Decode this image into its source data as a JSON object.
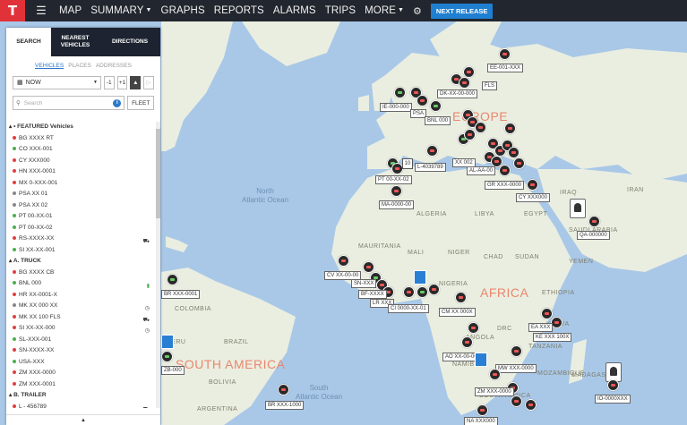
{
  "nav": {
    "logo": "T",
    "items": [
      "MAP",
      "SUMMARY",
      "GRAPHS",
      "REPORTS",
      "ALARMS",
      "TRIPS",
      "MORE"
    ],
    "dropdown_items": [
      "SUMMARY",
      "MORE"
    ],
    "next_release": "NEXT RELEASE",
    "icons": {
      "menu": "hamburger-icon",
      "settings": "gear-icon"
    }
  },
  "panel": {
    "tabs": [
      "SEARCH",
      "NEAREST VEHICLES",
      "DIRECTIONS"
    ],
    "active_tab": "SEARCH",
    "subtabs": [
      "VEHICLES",
      "PLACES",
      "ADDRESSES"
    ],
    "active_subtab": "VEHICLES",
    "time_select": "NOW",
    "step_back": "-1",
    "step_fwd": "+1",
    "search_placeholder": "Search",
    "fleet_button": "FLEET",
    "groups": [
      {
        "title": "• FEATURED Vehicles",
        "rows": [
          {
            "label": "BG XXXX RT",
            "dot": "#e04040"
          },
          {
            "label": "CO XXX-001",
            "dot": "#4caf50"
          },
          {
            "label": "CY XXX000",
            "dot": "#e04040"
          },
          {
            "label": "HN XXX-0001",
            "dot": "#e04040"
          },
          {
            "label": "MX 0-XXX-001",
            "dot": "#e04040"
          },
          {
            "label": "PSA XX 01",
            "dot": "#888888"
          },
          {
            "label": "PSA XX 02",
            "dot": "#888888"
          },
          {
            "label": "PT 00-XX-01",
            "dot": "#4caf50"
          },
          {
            "label": "PT 00-XX-02",
            "dot": "#4caf50"
          },
          {
            "label": "RS-XXXX-XX",
            "dot": "#e04040",
            "icon": "truck-icon"
          },
          {
            "label": "SI XX-XX-001",
            "dot": "#4caf50"
          }
        ]
      },
      {
        "title": "A. TRUCK",
        "rows": [
          {
            "label": "BG XXXX CB",
            "dot": "#e04040"
          },
          {
            "label": "BNL 000",
            "dot": "#4caf50",
            "icon": "battery-icon"
          },
          {
            "label": "HR XX-0001-X",
            "dot": "#e04040"
          },
          {
            "label": "MK XX 000 XX",
            "dot": "#888888",
            "icon": "clock-icon"
          },
          {
            "label": "MK XX 100 FLS",
            "dot": "#e04040",
            "icon": "truck-icon"
          },
          {
            "label": "SI XX-XX-000",
            "dot": "#e04040",
            "icon": "clock-icon"
          },
          {
            "label": "SL-XXX-001",
            "dot": "#4caf50"
          },
          {
            "label": "SN-XXXX-XX",
            "dot": "#e04040"
          },
          {
            "label": "USA-XXX",
            "dot": "#4caf50"
          },
          {
            "label": "ZM XXX-0000",
            "dot": "#e04040"
          },
          {
            "label": "ZM XXX-0001",
            "dot": "#e04040"
          }
        ]
      },
      {
        "title": "B. TRAILER",
        "rows": [
          {
            "label": "L - 456789",
            "dot": "#e04040",
            "icon": "truck-icon"
          }
        ]
      }
    ]
  },
  "map": {
    "regions": [
      "EUROPE",
      "AFRICA",
      "SOUTH AMERICA"
    ],
    "oceans": [
      "North\nAtlantic Ocean",
      "South\nAtlantic Ocean"
    ],
    "countries": [
      "ALGERIA",
      "LIBYA",
      "EGYPT",
      "MALI",
      "NIGER",
      "CHAD",
      "SUDAN",
      "ETHIOPIA",
      "BRAZIL",
      "COLOMBIA",
      "PERU",
      "BOLIVIA",
      "ARGENTINA",
      "SAUDI ARABIA",
      "YEMEN",
      "IRAN",
      "IRAQ",
      "MAURITANIA",
      "NIGERIA",
      "KENYA",
      "ANGOLA",
      "NAMIBIA",
      "SOUTH AFRICA",
      "MADAGASCAR",
      "TANZANIA",
      "DRC",
      "MOZAMBIQUE"
    ],
    "vehicle_labels": [
      "EE-001-XXX",
      "DK-XX-00-000",
      "FLS",
      "IE-000-000",
      "PSA",
      "BNL 000",
      "L-4039789",
      "XX 002",
      "AL-AA-00",
      "GR XXX-0000",
      "CY XXX000",
      "PT 00-XX-02",
      "MA-0000-00",
      "QA-000000",
      "CV XX-00-00",
      "SN-XXX",
      "BF-XXXX",
      "LR XXX",
      "CI 0000-XX-01",
      "CM XX 000X",
      "EA XXX",
      "KE XXX 100X",
      "AO XX-00-00",
      "MW XXX-0000",
      "ZM XXX-0000",
      "IO-0000XXX",
      "BR XXX-1000",
      "ZB-000",
      "NA XXX000",
      "BR XXX-0001"
    ],
    "cluster_count": "10",
    "colors": {
      "water": "#a9c8e8",
      "land": "#eaeee0",
      "region_label": "#e9876e",
      "accent": "#1f7fd0",
      "nav_bg": "#22262e"
    }
  }
}
